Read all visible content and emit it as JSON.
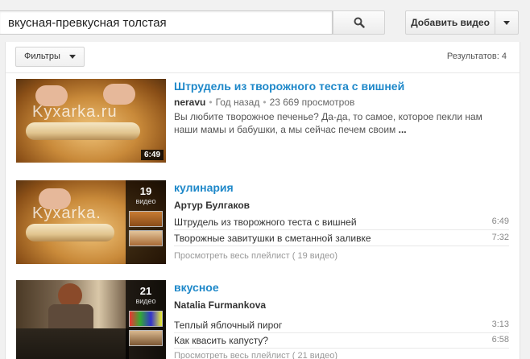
{
  "search": {
    "query": "вкусная-превкусная толстая",
    "upload_label": "Добавить видео"
  },
  "toolbar": {
    "filters_label": "Фильтры",
    "results_text": "Результатов: 4"
  },
  "results": [
    {
      "type": "video",
      "title": "Штрудель из творожного теста с вишней",
      "author": "neravu",
      "age": "Год назад",
      "views": "23 669 просмотров",
      "description": "Вы любите творожное печенье? Да-да, то самое, которое пекли нам наши мамы и бабушки, а мы сейчас печем своим",
      "more": "...",
      "duration": "6:49",
      "watermark": "Kyxarka.ru"
    },
    {
      "type": "playlist",
      "title": "кулинария",
      "author": "Артур Булгаков",
      "count": "19",
      "count_label": "видео",
      "watermark": "Kyxarka.",
      "items": [
        {
          "title": "Штрудель из творожного теста с вишней",
          "duration": "6:49"
        },
        {
          "title": "Творожные завитушки в сметанной заливке",
          "duration": "7:32"
        }
      ],
      "view_all": "Просмотреть весь плейлист ( 19 видео)"
    },
    {
      "type": "playlist",
      "title": "вкусное",
      "author": "Natalia Furmankova",
      "count": "21",
      "count_label": "видео",
      "items": [
        {
          "title": "Теплый яблочный пирог",
          "duration": "3:13"
        },
        {
          "title": "Как квасить капусту?",
          "duration": "6:58"
        }
      ],
      "view_all": "Просмотреть весь плейлист ( 21 видео)"
    }
  ],
  "icons": {
    "search": "search-icon",
    "dropdown": "chevron-down-icon"
  },
  "colors": {
    "link": "#1e88c9",
    "background": "#f1f1f1"
  }
}
